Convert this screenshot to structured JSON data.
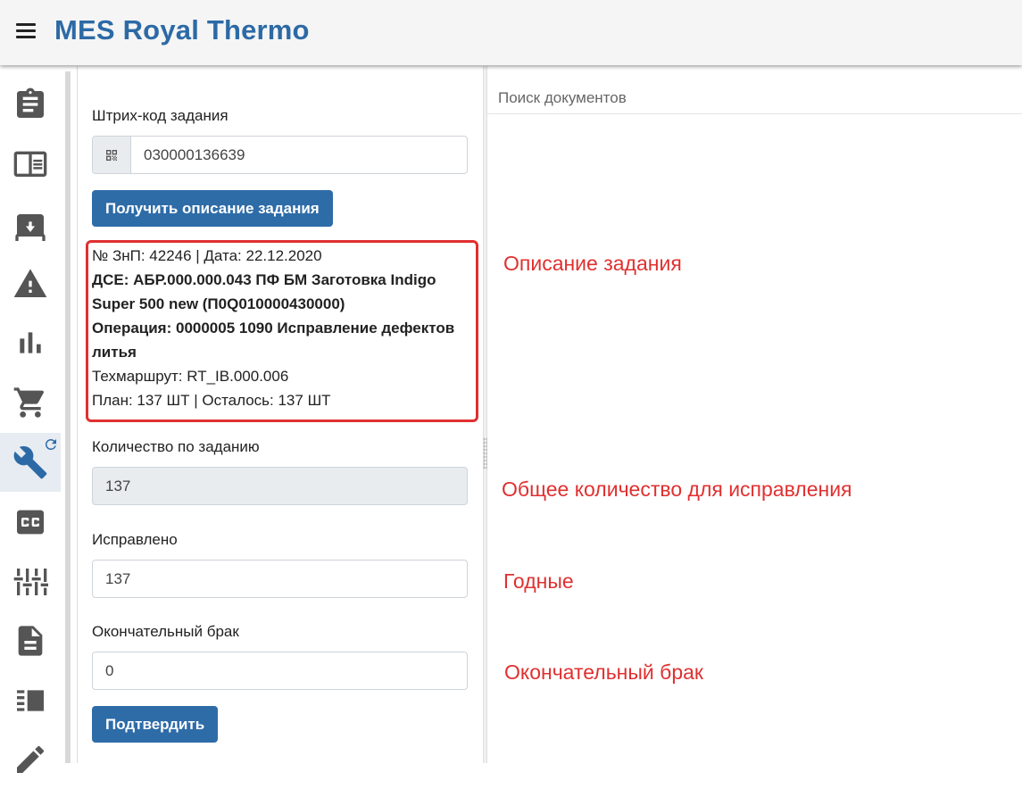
{
  "header": {
    "title": "MES Royal Thermo",
    "menu_icon": "menu-icon"
  },
  "sidebar": {
    "items": [
      {
        "icon": "clipboard-icon",
        "active": false
      },
      {
        "icon": "book-open-icon",
        "active": false
      },
      {
        "icon": "archive-icon",
        "active": false
      },
      {
        "icon": "warning-icon",
        "active": false
      },
      {
        "icon": "bar-chart-icon",
        "active": false
      },
      {
        "icon": "cart-icon",
        "active": false
      },
      {
        "icon": "wrench-icon",
        "active": true,
        "badge": "refresh-icon"
      },
      {
        "icon": "cc-icon",
        "active": false
      },
      {
        "icon": "sliders-icon",
        "active": false
      },
      {
        "icon": "document-icon",
        "active": false
      },
      {
        "icon": "list-view-icon",
        "active": false
      },
      {
        "icon": "pencil-icon",
        "active": false
      }
    ]
  },
  "form": {
    "barcode_label": "Штрих-код задания",
    "barcode_value": "030000136639",
    "get_description_button": "Получить описание задания",
    "description": {
      "line1": "№ ЗнП: 42246 | Дата: 22.12.2020",
      "line2": "ДСЕ: АБР.000.000.043 ПФ БМ Заготовка Indigo",
      "line3": "Super 500 new (П0Q010000430000)",
      "line4": "Операция: 0000005 1090 Исправление дефектов",
      "line5": "литья",
      "line6": "Техмаршрут: RT_IB.000.006",
      "line7": "План: 137 ШТ | Осталось: 137 ШТ"
    },
    "quantity_label": "Количество по заданию",
    "quantity_value": "137",
    "fixed_label": "Исправлено",
    "fixed_value": "137",
    "final_reject_label": "Окончательный брак",
    "final_reject_value": "0",
    "confirm_button": "Подтвердить"
  },
  "right_panel": {
    "search_label": "Поиск документов"
  },
  "annotations": {
    "description": "Описание задания",
    "total_quantity": "Общее количество для исправления",
    "good": "Годные",
    "final_reject": "Окончательный брак"
  },
  "colors": {
    "brand": "#2c6aa6",
    "button": "#2e6ca8",
    "annotation": "#e03030"
  }
}
